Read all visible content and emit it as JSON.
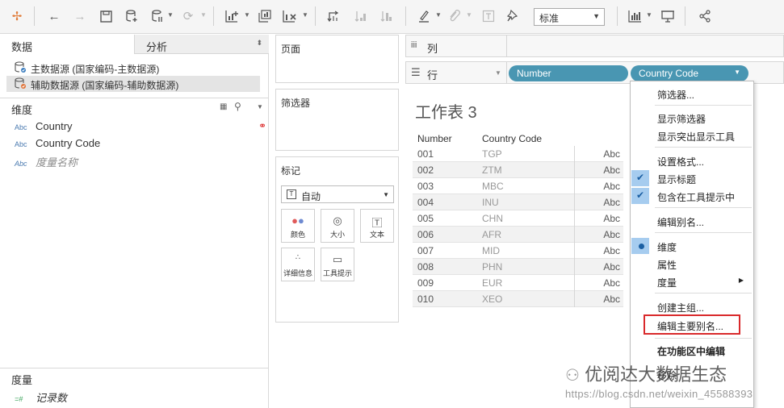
{
  "toolbar": {
    "fit_value": "标准",
    "icons": [
      "tableau-logo-icon",
      "undo-icon",
      "redo-icon",
      "save-icon",
      "new-datasource-icon",
      "pause-update-icon",
      "refresh-icon",
      "new-worksheet-icon",
      "duplicate-sheet-icon",
      "clear-sheet-icon",
      "swap-icon",
      "sort-asc-icon",
      "sort-desc-icon",
      "highlight-icon",
      "group-icon",
      "label-icon",
      "pin-icon",
      "chart-icon",
      "presentation-icon",
      "share-icon"
    ]
  },
  "data_pane": {
    "tab_data": "数据",
    "tab_analysis": "分析",
    "datasources": [
      {
        "label": "主数据源 (国家编码-主数据源)",
        "color": "#3d7ebf"
      },
      {
        "label": "辅助数据源 (国家编码-辅助数据源)",
        "color": "#e0743a"
      }
    ],
    "dimensions_label": "维度",
    "dimensions": [
      {
        "type": "Abc",
        "name": "Country"
      },
      {
        "type": "Abc",
        "name": "Country Code"
      },
      {
        "type": "Abc",
        "name": "度量名称"
      }
    ],
    "measures_label": "度量",
    "measures": [
      {
        "type": "=#",
        "name": "记录数"
      }
    ]
  },
  "shelves": {
    "pages": "页面",
    "filters": "筛选器",
    "marks": "标记",
    "mark_type": "自动",
    "mark_buttons": [
      "颜色",
      "大小",
      "文本",
      "详细信息",
      "工具提示"
    ],
    "columns": "列",
    "rows": "行",
    "row_pills": [
      "Number",
      "Country Code"
    ]
  },
  "worksheet": {
    "title": "工作表 3",
    "headers": [
      "Number",
      "Country Code"
    ],
    "rows": [
      {
        "number": "001",
        "code": "TGP",
        "value": "Abc"
      },
      {
        "number": "002",
        "code": "ZTM",
        "value": "Abc"
      },
      {
        "number": "003",
        "code": "MBC",
        "value": "Abc"
      },
      {
        "number": "004",
        "code": "INU",
        "value": "Abc"
      },
      {
        "number": "005",
        "code": "CHN",
        "value": "Abc"
      },
      {
        "number": "006",
        "code": "AFR",
        "value": "Abc"
      },
      {
        "number": "007",
        "code": "MID",
        "value": "Abc"
      },
      {
        "number": "008",
        "code": "PHN",
        "value": "Abc"
      },
      {
        "number": "009",
        "code": "EUR",
        "value": "Abc"
      },
      {
        "number": "010",
        "code": "XEO",
        "value": "Abc"
      }
    ]
  },
  "context_menu": {
    "items": [
      "筛选器...",
      "显示筛选器",
      "显示突出显示工具",
      "设置格式...",
      "显示标题",
      "包含在工具提示中",
      "编辑别名...",
      "维度",
      "属性",
      "度量",
      "创建主组...",
      "编辑主要别名...",
      "在功能区中编辑",
      "移除"
    ],
    "highlight_color": "#d9292b"
  },
  "watermark": {
    "text": "优阅达大数据生态",
    "url": "https://blog.csdn.net/weixin_45588393"
  }
}
